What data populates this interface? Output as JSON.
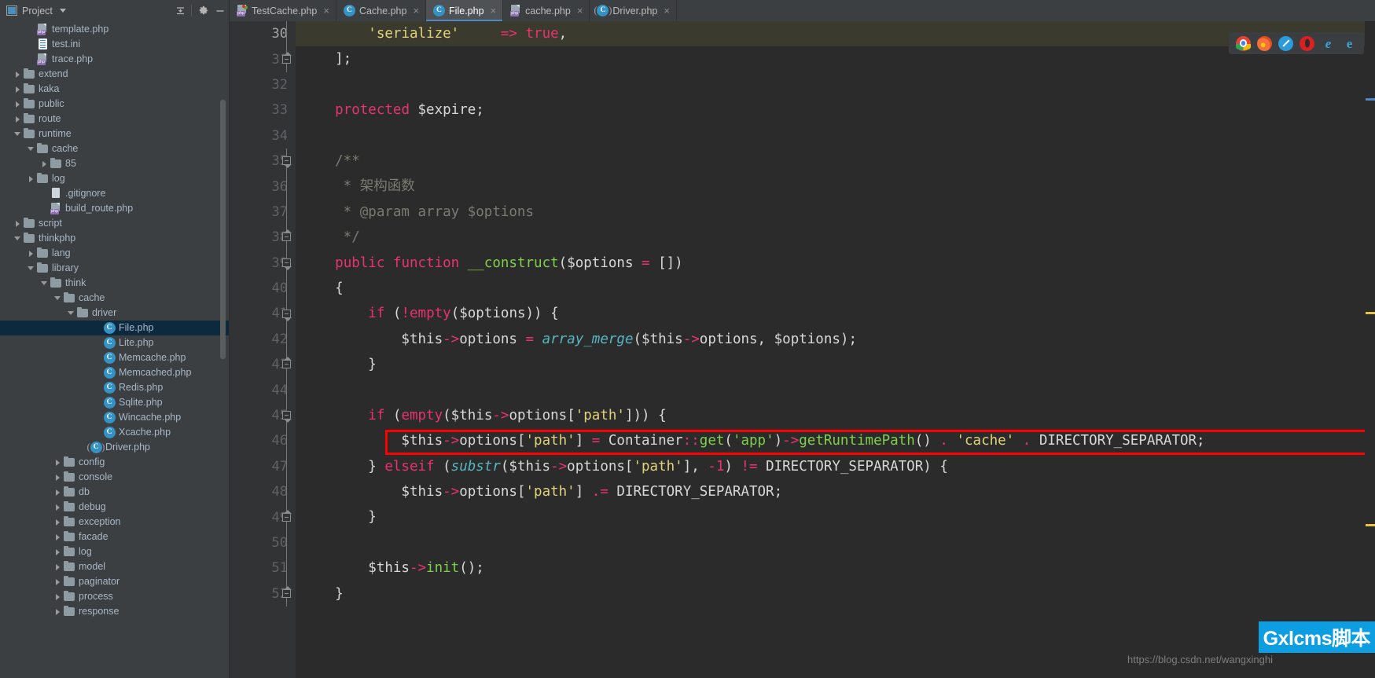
{
  "window": {
    "project_panel_title": "Project",
    "icons": {
      "project": "project-icon",
      "dropdown": "chevron-down-icon",
      "collapse_all": "collapse-all-icon",
      "settings": "gear-icon",
      "hide": "minimize-icon"
    }
  },
  "tabs": [
    {
      "label": "TestCache.php",
      "icon": "php-template-icon",
      "active": false,
      "close": "×"
    },
    {
      "label": "Cache.php",
      "icon": "php-class-icon",
      "active": false,
      "close": "×"
    },
    {
      "label": "File.php",
      "icon": "php-class-icon",
      "active": true,
      "close": "×"
    },
    {
      "label": "cache.php",
      "icon": "php-file-icon",
      "active": false,
      "close": "×"
    },
    {
      "label": "Driver.php",
      "icon": "php-abstract-class-icon",
      "active": false,
      "close": "×"
    }
  ],
  "sidebar": {
    "nodes": [
      {
        "label": "template.php",
        "indent": 2,
        "twisty": "none",
        "icon": "php-file-icon",
        "selected": false
      },
      {
        "label": "test.ini",
        "indent": 2,
        "twisty": "none",
        "icon": "ini-file-icon",
        "selected": false
      },
      {
        "label": "trace.php",
        "indent": 2,
        "twisty": "none",
        "icon": "php-file-icon",
        "selected": false
      },
      {
        "label": "extend",
        "indent": 1,
        "twisty": "collapsed",
        "icon": "folder-icon",
        "selected": false
      },
      {
        "label": "kaka",
        "indent": 1,
        "twisty": "collapsed",
        "icon": "folder-icon",
        "selected": false
      },
      {
        "label": "public",
        "indent": 1,
        "twisty": "collapsed",
        "icon": "folder-icon",
        "selected": false
      },
      {
        "label": "route",
        "indent": 1,
        "twisty": "collapsed",
        "icon": "folder-icon",
        "selected": false
      },
      {
        "label": "runtime",
        "indent": 1,
        "twisty": "expanded",
        "icon": "folder-icon",
        "selected": false
      },
      {
        "label": "cache",
        "indent": 2,
        "twisty": "expanded",
        "icon": "folder-icon",
        "selected": false
      },
      {
        "label": "85",
        "indent": 3,
        "twisty": "collapsed",
        "icon": "folder-icon",
        "selected": false
      },
      {
        "label": "log",
        "indent": 2,
        "twisty": "collapsed",
        "icon": "folder-icon",
        "selected": false
      },
      {
        "label": ".gitignore",
        "indent": 3,
        "twisty": "none",
        "icon": "text-file-icon",
        "selected": false
      },
      {
        "label": "build_route.php",
        "indent": 3,
        "twisty": "none",
        "icon": "php-file-icon",
        "selected": false
      },
      {
        "label": "script",
        "indent": 1,
        "twisty": "collapsed",
        "icon": "folder-icon",
        "selected": false
      },
      {
        "label": "thinkphp",
        "indent": 1,
        "twisty": "expanded",
        "icon": "folder-icon",
        "selected": false
      },
      {
        "label": "lang",
        "indent": 2,
        "twisty": "collapsed",
        "icon": "folder-icon",
        "selected": false
      },
      {
        "label": "library",
        "indent": 2,
        "twisty": "expanded",
        "icon": "folder-icon",
        "selected": false
      },
      {
        "label": "think",
        "indent": 3,
        "twisty": "expanded",
        "icon": "folder-icon",
        "selected": false
      },
      {
        "label": "cache",
        "indent": 4,
        "twisty": "expanded",
        "icon": "folder-icon",
        "selected": false
      },
      {
        "label": "driver",
        "indent": 5,
        "twisty": "expanded",
        "icon": "folder-icon",
        "selected": false
      },
      {
        "label": "File.php",
        "indent": 7,
        "twisty": "none",
        "icon": "php-class-icon",
        "selected": true
      },
      {
        "label": "Lite.php",
        "indent": 7,
        "twisty": "none",
        "icon": "php-class-icon",
        "selected": false
      },
      {
        "label": "Memcache.php",
        "indent": 7,
        "twisty": "none",
        "icon": "php-class-icon",
        "selected": false
      },
      {
        "label": "Memcached.php",
        "indent": 7,
        "twisty": "none",
        "icon": "php-class-icon",
        "selected": false
      },
      {
        "label": "Redis.php",
        "indent": 7,
        "twisty": "none",
        "icon": "php-class-icon",
        "selected": false
      },
      {
        "label": "Sqlite.php",
        "indent": 7,
        "twisty": "none",
        "icon": "php-class-icon",
        "selected": false
      },
      {
        "label": "Wincache.php",
        "indent": 7,
        "twisty": "none",
        "icon": "php-class-icon",
        "selected": false
      },
      {
        "label": "Xcache.php",
        "indent": 7,
        "twisty": "none",
        "icon": "php-class-icon",
        "selected": false
      },
      {
        "label": "Driver.php",
        "indent": 6,
        "twisty": "none",
        "icon": "php-abstract-class-icon",
        "selected": false
      },
      {
        "label": "config",
        "indent": 4,
        "twisty": "collapsed",
        "icon": "folder-icon",
        "selected": false
      },
      {
        "label": "console",
        "indent": 4,
        "twisty": "collapsed",
        "icon": "folder-icon",
        "selected": false
      },
      {
        "label": "db",
        "indent": 4,
        "twisty": "collapsed",
        "icon": "folder-icon",
        "selected": false
      },
      {
        "label": "debug",
        "indent": 4,
        "twisty": "collapsed",
        "icon": "folder-icon",
        "selected": false
      },
      {
        "label": "exception",
        "indent": 4,
        "twisty": "collapsed",
        "icon": "folder-icon",
        "selected": false
      },
      {
        "label": "facade",
        "indent": 4,
        "twisty": "collapsed",
        "icon": "folder-icon",
        "selected": false
      },
      {
        "label": "log",
        "indent": 4,
        "twisty": "collapsed",
        "icon": "folder-icon",
        "selected": false
      },
      {
        "label": "model",
        "indent": 4,
        "twisty": "collapsed",
        "icon": "folder-icon",
        "selected": false
      },
      {
        "label": "paginator",
        "indent": 4,
        "twisty": "collapsed",
        "icon": "folder-icon",
        "selected": false
      },
      {
        "label": "process",
        "indent": 4,
        "twisty": "collapsed",
        "icon": "folder-icon",
        "selected": false
      },
      {
        "label": "response",
        "indent": 4,
        "twisty": "collapsed",
        "icon": "folder-icon",
        "selected": false
      }
    ]
  },
  "editor": {
    "first_line": 30,
    "current_line": 30,
    "lines": [
      {
        "num": "30",
        "fold": "none",
        "highlight": true,
        "tokens": [
          {
            "t": "        ",
            "c": "plain"
          },
          {
            "t": "'serialize'",
            "c": "str"
          },
          {
            "t": "     ",
            "c": "plain"
          },
          {
            "t": "=>",
            "c": "op"
          },
          {
            "t": " ",
            "c": "plain"
          },
          {
            "t": "true",
            "c": "kw"
          },
          {
            "t": ",",
            "c": "plain"
          }
        ]
      },
      {
        "num": "31",
        "fold": "end",
        "highlight": false,
        "tokens": [
          {
            "t": "    ];",
            "c": "plain"
          }
        ]
      },
      {
        "num": "32",
        "fold": "none",
        "highlight": false,
        "tokens": [
          {
            "t": "",
            "c": "plain"
          }
        ]
      },
      {
        "num": "33",
        "fold": "none",
        "highlight": false,
        "tokens": [
          {
            "t": "    ",
            "c": "plain"
          },
          {
            "t": "protected",
            "c": "kw"
          },
          {
            "t": " $expire;",
            "c": "plain"
          }
        ]
      },
      {
        "num": "34",
        "fold": "none",
        "highlight": false,
        "tokens": [
          {
            "t": "",
            "c": "plain"
          }
        ]
      },
      {
        "num": "35",
        "fold": "start",
        "highlight": false,
        "tokens": [
          {
            "t": "    /**",
            "c": "cmt"
          }
        ]
      },
      {
        "num": "36",
        "fold": "none",
        "highlight": false,
        "tokens": [
          {
            "t": "     * 架构函数",
            "c": "cmt"
          }
        ]
      },
      {
        "num": "37",
        "fold": "none",
        "highlight": false,
        "tokens": [
          {
            "t": "     * @param array $options",
            "c": "cmt"
          }
        ]
      },
      {
        "num": "38",
        "fold": "end",
        "highlight": false,
        "tokens": [
          {
            "t": "     */",
            "c": "cmt"
          }
        ]
      },
      {
        "num": "39",
        "fold": "start",
        "highlight": false,
        "tokens": [
          {
            "t": "    ",
            "c": "plain"
          },
          {
            "t": "public function",
            "c": "kw"
          },
          {
            "t": " ",
            "c": "plain"
          },
          {
            "t": "__construct",
            "c": "greenfn"
          },
          {
            "t": "($options ",
            "c": "plain"
          },
          {
            "t": "=",
            "c": "op"
          },
          {
            "t": " [])",
            "c": "plain"
          }
        ]
      },
      {
        "num": "40",
        "fold": "none",
        "highlight": false,
        "tokens": [
          {
            "t": "    {",
            "c": "plain"
          }
        ]
      },
      {
        "num": "41",
        "fold": "start",
        "highlight": false,
        "tokens": [
          {
            "t": "        ",
            "c": "plain"
          },
          {
            "t": "if",
            "c": "kw"
          },
          {
            "t": " (",
            "c": "plain"
          },
          {
            "t": "!",
            "c": "op"
          },
          {
            "t": "empty",
            "c": "kw"
          },
          {
            "t": "($options)) {",
            "c": "plain"
          }
        ]
      },
      {
        "num": "42",
        "fold": "none",
        "highlight": false,
        "tokens": [
          {
            "t": "            $this",
            "c": "plain"
          },
          {
            "t": "->",
            "c": "arrow"
          },
          {
            "t": "options ",
            "c": "plain"
          },
          {
            "t": "=",
            "c": "op"
          },
          {
            "t": " ",
            "c": "plain"
          },
          {
            "t": "array_merge",
            "c": "fn"
          },
          {
            "t": "($this",
            "c": "plain"
          },
          {
            "t": "->",
            "c": "arrow"
          },
          {
            "t": "options, $options);",
            "c": "plain"
          }
        ]
      },
      {
        "num": "43",
        "fold": "end",
        "highlight": false,
        "tokens": [
          {
            "t": "        }",
            "c": "plain"
          }
        ]
      },
      {
        "num": "44",
        "fold": "none",
        "highlight": false,
        "tokens": [
          {
            "t": "",
            "c": "plain"
          }
        ]
      },
      {
        "num": "45",
        "fold": "start",
        "highlight": false,
        "tokens": [
          {
            "t": "        ",
            "c": "plain"
          },
          {
            "t": "if",
            "c": "kw"
          },
          {
            "t": " (",
            "c": "plain"
          },
          {
            "t": "empty",
            "c": "kw"
          },
          {
            "t": "($this",
            "c": "plain"
          },
          {
            "t": "->",
            "c": "arrow"
          },
          {
            "t": "options[",
            "c": "plain"
          },
          {
            "t": "'path'",
            "c": "str"
          },
          {
            "t": "])) {",
            "c": "plain"
          }
        ]
      },
      {
        "num": "46",
        "fold": "none",
        "highlight": false,
        "boxed": true,
        "tokens": [
          {
            "t": "            $this",
            "c": "plain"
          },
          {
            "t": "->",
            "c": "arrow"
          },
          {
            "t": "options[",
            "c": "plain"
          },
          {
            "t": "'path'",
            "c": "str"
          },
          {
            "t": "] ",
            "c": "plain"
          },
          {
            "t": "=",
            "c": "op"
          },
          {
            "t": " Container",
            "c": "plain"
          },
          {
            "t": "::",
            "c": "op"
          },
          {
            "t": "get",
            "c": "greenfn"
          },
          {
            "t": "(",
            "c": "plain"
          },
          {
            "t": "'app'",
            "c": "greenfn"
          },
          {
            "t": ")",
            "c": "plain"
          },
          {
            "t": "->",
            "c": "arrow"
          },
          {
            "t": "getRuntimePath",
            "c": "greenfn"
          },
          {
            "t": "() ",
            "c": "plain"
          },
          {
            "t": ".",
            "c": "dot"
          },
          {
            "t": " ",
            "c": "plain"
          },
          {
            "t": "'cache'",
            "c": "str"
          },
          {
            "t": " ",
            "c": "plain"
          },
          {
            "t": ".",
            "c": "dot"
          },
          {
            "t": " DIRECTORY_SEPARATOR;",
            "c": "plain"
          }
        ]
      },
      {
        "num": "47",
        "fold": "none",
        "highlight": false,
        "tokens": [
          {
            "t": "        } ",
            "c": "plain"
          },
          {
            "t": "elseif",
            "c": "kw"
          },
          {
            "t": " (",
            "c": "plain"
          },
          {
            "t": "substr",
            "c": "fn"
          },
          {
            "t": "($this",
            "c": "plain"
          },
          {
            "t": "->",
            "c": "arrow"
          },
          {
            "t": "options[",
            "c": "plain"
          },
          {
            "t": "'path'",
            "c": "str"
          },
          {
            "t": "], ",
            "c": "plain"
          },
          {
            "t": "-1",
            "c": "num"
          },
          {
            "t": ") ",
            "c": "plain"
          },
          {
            "t": "!=",
            "c": "op"
          },
          {
            "t": " DIRECTORY_SEPARATOR) {",
            "c": "plain"
          }
        ]
      },
      {
        "num": "48",
        "fold": "none",
        "highlight": false,
        "tokens": [
          {
            "t": "            $this",
            "c": "plain"
          },
          {
            "t": "->",
            "c": "arrow"
          },
          {
            "t": "options[",
            "c": "plain"
          },
          {
            "t": "'path'",
            "c": "str"
          },
          {
            "t": "] ",
            "c": "plain"
          },
          {
            "t": ".=",
            "c": "op"
          },
          {
            "t": " DIRECTORY_SEPARATOR;",
            "c": "plain"
          }
        ]
      },
      {
        "num": "49",
        "fold": "end",
        "highlight": false,
        "tokens": [
          {
            "t": "        }",
            "c": "plain"
          }
        ]
      },
      {
        "num": "50",
        "fold": "none",
        "highlight": false,
        "tokens": [
          {
            "t": "",
            "c": "plain"
          }
        ]
      },
      {
        "num": "51",
        "fold": "none",
        "highlight": false,
        "tokens": [
          {
            "t": "        $this",
            "c": "plain"
          },
          {
            "t": "->",
            "c": "arrow"
          },
          {
            "t": "init",
            "c": "greenfn"
          },
          {
            "t": "();",
            "c": "plain"
          }
        ]
      },
      {
        "num": "52",
        "fold": "end",
        "highlight": false,
        "tokens": [
          {
            "t": "    }",
            "c": "plain"
          }
        ]
      }
    ]
  },
  "browser_strip": {
    "icons": [
      {
        "name": "chrome-icon",
        "glyph": ""
      },
      {
        "name": "firefox-icon",
        "glyph": ""
      },
      {
        "name": "safari-icon",
        "glyph": ""
      },
      {
        "name": "opera-icon",
        "glyph": ""
      },
      {
        "name": "ie-icon",
        "glyph": "e"
      },
      {
        "name": "edge-icon",
        "glyph": "e"
      }
    ]
  },
  "watermark": {
    "url": "https://blog.csdn.net/wangxinghi",
    "badge": "Gxlcms脚本"
  },
  "colors": {
    "accent": "#4a88c7",
    "selection": "#0d293e",
    "editor_bg": "#2b2b2b",
    "gutter_bg": "#313335",
    "panel_bg": "#3c3f41",
    "highlight_box": "#ff0000",
    "current_line": "#3a3a2e",
    "badge_bg": "#0d9ee2"
  }
}
